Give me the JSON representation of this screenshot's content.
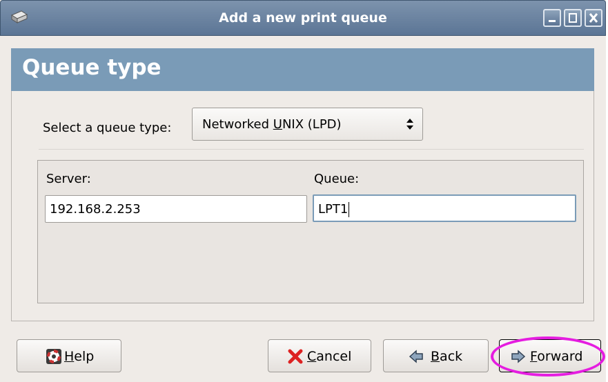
{
  "window": {
    "title": "Add a new print queue"
  },
  "header": {
    "title": "Queue type"
  },
  "queue_type": {
    "label": "Select a queue type:",
    "selected_pre": "Networked ",
    "selected_u": "U",
    "selected_post": "NIX (LPD)"
  },
  "server": {
    "label": "Server:",
    "value": "192.168.2.253"
  },
  "queue": {
    "label": "Queue:",
    "value": "LPT1"
  },
  "buttons": {
    "help": {
      "u": "H",
      "rest": "elp"
    },
    "cancel": {
      "u": "C",
      "rest": "ancel"
    },
    "back": {
      "u": "B",
      "rest": "ack"
    },
    "forward": {
      "u": "F",
      "rest": "orward"
    }
  },
  "colors": {
    "titlebar": "#5b7595",
    "header": "#7a9bb7",
    "highlight": "#e51de0"
  },
  "icons": [
    "printer-icon",
    "minimize-icon",
    "maximize-icon",
    "close-icon",
    "updown-arrows-icon",
    "lifebuoy-icon",
    "cross-icon",
    "back-arrow-icon",
    "forward-arrow-icon"
  ]
}
